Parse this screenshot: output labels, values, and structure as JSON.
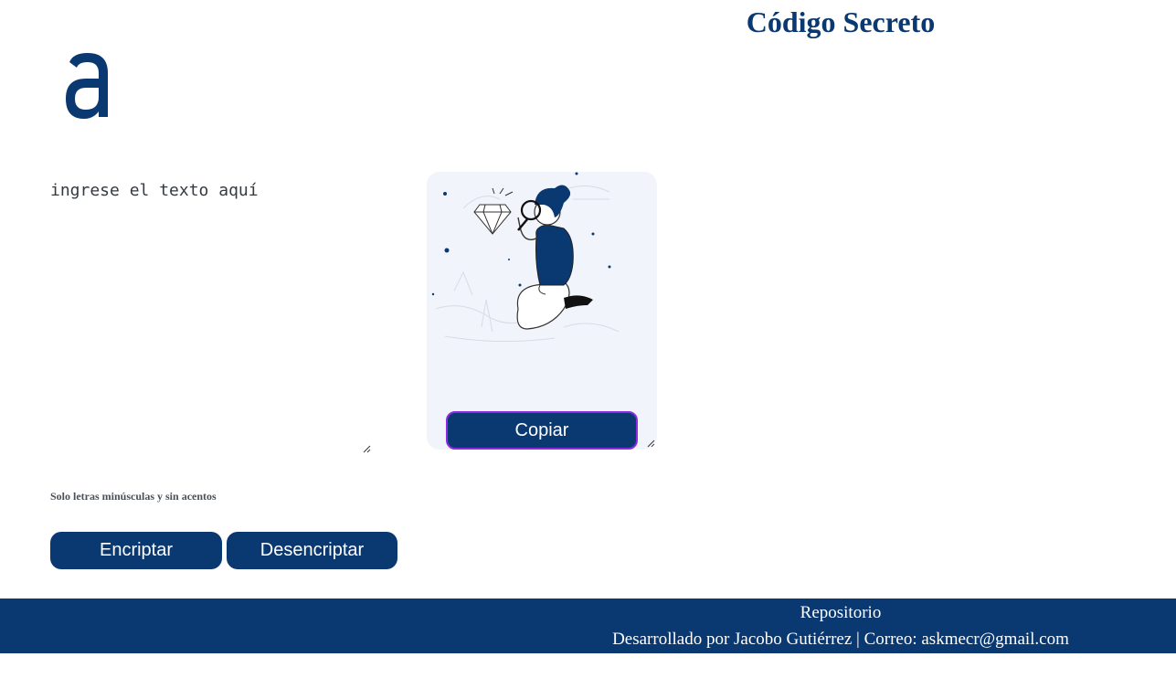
{
  "header": {
    "title": "Código Secreto",
    "logo_icon": "alura-a-logo-icon"
  },
  "editor": {
    "placeholder": "ingrese el texto aquí"
  },
  "output": {
    "illustration_icon": "person-with-magnifier-and-diamond-illustration",
    "copy_label": "Copiar"
  },
  "hint": "Solo letras minúsculas y sin acentos",
  "actions": {
    "encrypt_label": "Encriptar",
    "decrypt_label": "Desencriptar"
  },
  "footer": {
    "repo_link": "Repositorio",
    "credit": "Desarrollado por Jacobo Gutiérrez | Correo: askmecr@gmail.com"
  },
  "colors": {
    "brand": "#0a3871",
    "panel_bg": "#f1f4fb",
    "copy_border": "#8a2be2"
  }
}
